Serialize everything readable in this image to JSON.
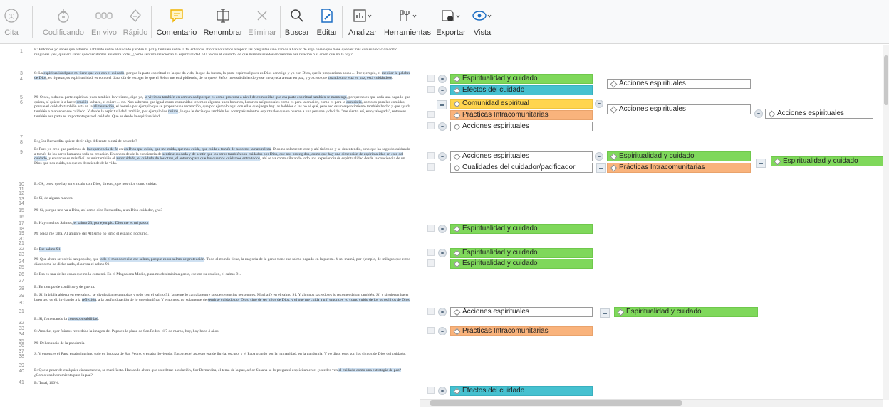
{
  "toolbar": {
    "buttons": [
      {
        "key": "cita",
        "label": "Cita",
        "icon": "quote-count-icon",
        "badge": "(1)",
        "enabled": false
      },
      {
        "key": "codificando",
        "label": "Codificando",
        "icon": "code-add-icon",
        "enabled": false
      },
      {
        "key": "en_vivo",
        "label": "En vivo",
        "icon": "live-code-icon",
        "enabled": false
      },
      {
        "key": "rapido",
        "label": "Rápido",
        "icon": "quick-code-icon",
        "enabled": false
      },
      {
        "key": "comentario",
        "label": "Comentario",
        "icon": "comment-icon",
        "enabled": true
      },
      {
        "key": "renombrar",
        "label": "Renombrar",
        "icon": "rename-icon",
        "enabled": true
      },
      {
        "key": "eliminar",
        "label": "Eliminar",
        "icon": "delete-icon",
        "enabled": false
      },
      {
        "key": "buscar",
        "label": "Buscar",
        "icon": "search-icon",
        "enabled": true
      },
      {
        "key": "editar",
        "label": "Editar",
        "icon": "edit-icon",
        "enabled": true
      },
      {
        "key": "analizar",
        "label": "Analizar",
        "icon": "analyze-icon",
        "enabled": true
      },
      {
        "key": "herramientas",
        "label": "Herramientas",
        "icon": "tools-icon",
        "enabled": true
      },
      {
        "key": "exportar",
        "label": "Exportar",
        "icon": "export-icon",
        "enabled": true
      },
      {
        "key": "vista",
        "label": "Vista",
        "icon": "view-icon",
        "enabled": true
      }
    ]
  },
  "document": {
    "line_numbers": [
      "1",
      "3",
      "4",
      "5",
      "6",
      "7",
      "8",
      "9",
      "10",
      "11",
      "12",
      "13",
      "14",
      "15",
      "16",
      "17",
      "18",
      "19",
      "20",
      "21",
      "22",
      "23",
      "24",
      "25",
      "26",
      "27",
      "28",
      "29",
      "30",
      "31",
      "32",
      "33",
      "34",
      "35",
      "36",
      "37",
      "38",
      "39",
      "40",
      "41"
    ],
    "paragraphs": [
      {
        "runs": [
          {
            "t": "E: Entonces yo sabes que estamos hablando sobre el cuidado y sobre la paz y también sobre la fe, entonces ahorita no vamos a repetir las preguntas sino vamos a hablar de algo nuevo que tiene que ver más con su vocación como religiosas y es, quisiera saber qué discutamos ahí entre todas, ¿cómo sentiste relacionan la espiritualidad o la fe con el cuidado, de qué manera ustedes encuentran esa relación o si creen que no la hay?"
          }
        ]
      },
      {
        "runs": [
          {
            "t": "S: La "
          },
          {
            "t": "espiritualidad para mí tiene que ver con el cuidado",
            "h": true
          },
          {
            "t": ", porque la parte espiritual es la que da vida, la que da fuerza, la parte espiritual pues es Dios conmigo y yo con Dios, que le proporciona a uno… Por ejemplo, el "
          },
          {
            "t": "meditar la palabra de Dios",
            "h": true
          },
          {
            "t": ", es riqueza, es espiritualidad, es como el día a día de escoger lo que el Señor me está pidiendo, de lo que el Señor me está diciendo y ese me ayuda a estar en paz, y yo creo que "
          },
          {
            "t": "cuando uno está en paz, está cuidándose",
            "h": true
          },
          {
            "t": "."
          }
        ]
      },
      {
        "runs": [
          {
            "t": "M: O sea, toda esa parte espiritual pues también la vivimos, digo yo, "
          },
          {
            "t": "la vivimos también en comunidad porque es como procurar a nivel de comunidad que esa parte espiritual también se mantenga",
            "h": true
          },
          {
            "t": ", porque no es que cada una haga lo que quiera, sí quiere ir a hacer "
          },
          {
            "t": "oración",
            "h": true
          },
          {
            "t": " la hace, sí quiere… no. Nos sabemos que igual como comunidad tenemos algunos unos horarios, horarios así puntuales como es para la oración, como es para la "
          },
          {
            "t": "eucaristía",
            "h": true
          },
          {
            "t": ", como es para las comidas, porque el cuidado también está en la "
          },
          {
            "t": "alimentación",
            "h": true
          },
          {
            "t": ", el horario por ejemplo que se propuso una recreación, que por ejemplo aquí con ellas que juega hay las hobbies o las no sé qué, pero eso es un esparcimiento también hecho y que ayuda también a mantener ese cuidado. Y desde la espiritualidad también, por ejemplo los "
          },
          {
            "t": "retiros",
            "h": true
          },
          {
            "t": ", lo que le decía que también los acompañamientos espirituales que se buscan a una persona y decirle: \"me siento así, estoy ahogada\", entonces también esa parte es importante para el cuidado. Que es desde la espiritualidad."
          }
        ]
      },
      {
        "runs": [
          {
            "t": "E: ¿Sor Bernardita quiere decir algo diferente o está de acuerdo?"
          }
        ]
      },
      {
        "runs": [
          {
            "t": "B: Pues yo creo que partimos de "
          },
          {
            "t": "la experiencia de fe",
            "h": true
          },
          {
            "t": " en "
          },
          {
            "t": "un Dios que cuida, que me cuida, que nos cuida, que cuida a través de nosotros la naturaleza",
            "h": true
          },
          {
            "t": ". Dios no solamente cree y ahí tiró todo y se desentendió, sino que ha seguido cuidando a través de los seres humanos toda su creación. Entonces desde la conciencia de "
          },
          {
            "t": "sentirse cuidada y de sentir que los otros también son cuidados por Dios, que nos protegidos, como que hay una dimensión de espiritualidad en este del cuidado",
            "h": true
          },
          {
            "t": ", y entonces es más fácil asumir también el "
          },
          {
            "t": "autocuidado, el cuidado de los otros, el entorno para que busquemos cuidarnos entre todos",
            "h": true
          },
          {
            "t": ", ahí se va como dilatando todo una experiencia de espiritualidad desde la conciencia de un Dios que nos cuida, no que es desatiende de la vida."
          }
        ]
      },
      {
        "runs": [
          {
            "t": "E: Ok, o sea que hay un vínculo con Dios, directo, que nos dice como cuidar."
          }
        ]
      },
      {
        "runs": [
          {
            "t": "B: Sí, de alguna manera."
          }
        ]
      },
      {
        "runs": [
          {
            "t": "M: Sí, porque uno va a Dios, así como dice Bernardita, a un Dios cuidador, ¿no?"
          }
        ]
      },
      {
        "runs": [
          {
            "t": "B: Hay muchos Salmos, "
          },
          {
            "t": "el salmo 23, por ejemplo. Dios me es mi pastor",
            "h": true
          }
        ]
      },
      {
        "runs": [
          {
            "t": "M: Nada me falta. Al amparo del Altísimo no temo el espanto nocturno."
          }
        ]
      },
      {
        "runs": [
          {
            "t": "B: "
          },
          {
            "t": "Ese salmo 91",
            "h": true
          },
          {
            "t": "."
          }
        ]
      },
      {
        "runs": [
          {
            "t": "M: Que ahora se volvió tan popular, que "
          },
          {
            "t": "todo el mundo recita ese salmo, porque es un salmo de protección",
            "h": true
          },
          {
            "t": ". Todo el mundo tiene, la mayoría de la gente tiene ese salmo pegado en la puerta. Y mi mamá, por ejemplo, de milagro que estos días no me ha dicho nada, ella reza el salmo 91."
          }
        ]
      },
      {
        "runs": [
          {
            "t": "B: Esa es una de las cosas que no la comentí. En el Magdalena Medio, para muchísimísima gente, ese era su oración, el salmo 91."
          }
        ]
      },
      {
        "runs": [
          {
            "t": "E: En tiempo de conflicto y de guerra."
          }
        ]
      },
      {
        "runs": [
          {
            "t": "B: Sí, la biblia abierta en ese salmo, se divulgaban estampitas y todo con el salmo 91, la gente lo cargaba entre sus pertenencias personales. Mucha fe en el salmo 91. Y algunos sacerdotes lo recomendaban también. Sí, y siguieron hacer buen uso de él, invitando a la "
          },
          {
            "t": "reflexión",
            "h": true
          },
          {
            "t": ", a la profundización de lo que significa. Y entonces, no solamente de "
          },
          {
            "t": "sentirse cuidado por Dios, sino de ser hijos de Dios, y el que me cuida a mí, entonces yo como cuido de los otros hijos de Dios",
            "h": true
          },
          {
            "t": "."
          }
        ]
      },
      {
        "runs": [
          {
            "t": "E: Sí, fomentando la "
          },
          {
            "t": "corresponsabilidad",
            "h": true
          },
          {
            "t": "."
          }
        ]
      },
      {
        "runs": [
          {
            "t": "S: Anoche, ayer fuimos recordaba la imagen del Papa en la plaza de San Pedro, el 7 de marzo, hoy, hoy hace 4 años."
          }
        ]
      },
      {
        "runs": [
          {
            "t": "M: Del anuncio de la pandemia."
          }
        ]
      },
      {
        "runs": [
          {
            "t": "S: Y entonces el Papa estaba ingrimo solo en la plaza de San Pedro, y estaba lloviendo. Entonces el aspecto era de lluvia, oscuro, y el Papa orando por la humanidad, en la pandemia. Y yo digo, esos son los signos de Dios del cuidado."
          }
        ]
      },
      {
        "runs": [
          {
            "t": "E: Que a pesar de cualquier circunstancia, se manifiesta. Hablando ahora que usted trae a colación, Sor Bernardita, el tema de la paz, a Sor Susana se lo preguntó explícitamente, ¿ustedes ven "
          },
          {
            "t": "el cuidado como una estrategia de paz?",
            "h": true
          },
          {
            "t": " ¿Como una herramienta para la paz?"
          }
        ]
      },
      {
        "runs": [
          {
            "t": "B: Total, 100%."
          }
        ]
      }
    ]
  },
  "codes": {
    "tags": [
      {
        "label": "Espiritualidad y cuidado",
        "color": "green"
      },
      {
        "label": "Efectos del cuidado",
        "color": "cyan"
      },
      {
        "label": "Acciones espirituales",
        "color": "white"
      },
      {
        "label": "Comunidad espiritual",
        "color": "yellow"
      },
      {
        "label": "Prácticas Intracomunitarias",
        "color": "orange"
      },
      {
        "label": "Acciones espirituales",
        "color": "white"
      },
      {
        "label": "Acciones espirituales",
        "color": "white"
      },
      {
        "label": "Acciones espirituales",
        "color": "white"
      },
      {
        "label": "Acciones espirituales",
        "color": "white"
      },
      {
        "label": "Cualidades del cuidador/pacificador",
        "color": "white"
      },
      {
        "label": "Espiritualidad y cuidado",
        "color": "green"
      },
      {
        "label": "Prácticas Intracomunitarias",
        "color": "orange"
      },
      {
        "label": "Espiritualidad y cuidado",
        "color": "green"
      },
      {
        "label": "Espiritualidad y cuidado",
        "color": "green"
      },
      {
        "label": "Espiritualidad y cuidado",
        "color": "green"
      },
      {
        "label": "Espiritualidad y cuidado",
        "color": "green"
      },
      {
        "label": "Acciones espirituales",
        "color": "white"
      },
      {
        "label": "Espiritualidad y cuidado",
        "color": "green"
      },
      {
        "label": "Prácticas Intracomunitarias",
        "color": "orange"
      },
      {
        "label": "Efectos del cuidado",
        "color": "cyan"
      }
    ]
  },
  "colors": {
    "green": "#7fd85b",
    "cyan": "#46c1d0",
    "yellow": "#ffd54f",
    "orange": "#f9b37c",
    "highlight": "#cfe1f2"
  }
}
